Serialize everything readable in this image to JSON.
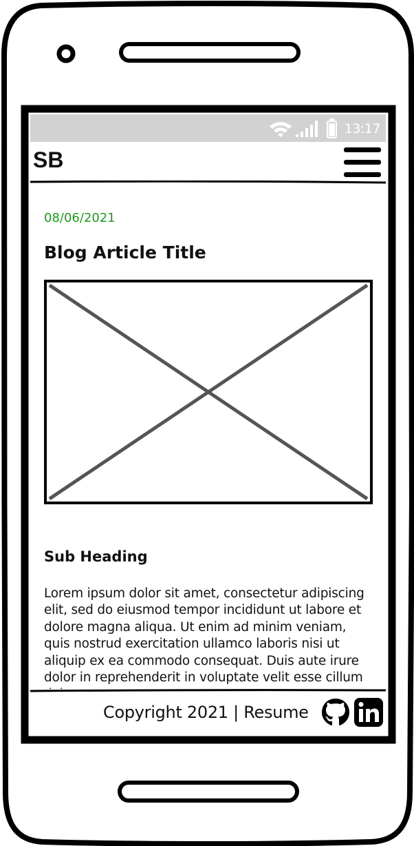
{
  "status_bar": {
    "time": "13:17",
    "icons": [
      "wifi-icon",
      "signal-icon",
      "battery-icon"
    ]
  },
  "header": {
    "brand": "SB",
    "menu_icon": "hamburger-menu-icon"
  },
  "article": {
    "date": "08/06/2021",
    "title": "Blog Article Title",
    "image_placeholder": "image-placeholder",
    "sub_heading": "Sub Heading",
    "body": "Lorem ipsum dolor sit amet, consectetur adipiscing elit, sed do eiusmod tempor incididunt ut labore et dolore magna aliqua. Ut enim ad minim veniam, quis nostrud exercitation ullamco laboris nisi ut aliquip ex ea commodo consequat. Duis aute irure dolor in reprehenderit in voluptate velit esse cillum dolore eu"
  },
  "footer": {
    "copyright": "Copyright 2021 | Resume",
    "icons": [
      "github-icon",
      "linkedin-icon"
    ]
  },
  "colors": {
    "date_green": "#1a9a1a",
    "status_bar_gray": "#d2d2d2",
    "placeholder_gray": "#555555"
  }
}
